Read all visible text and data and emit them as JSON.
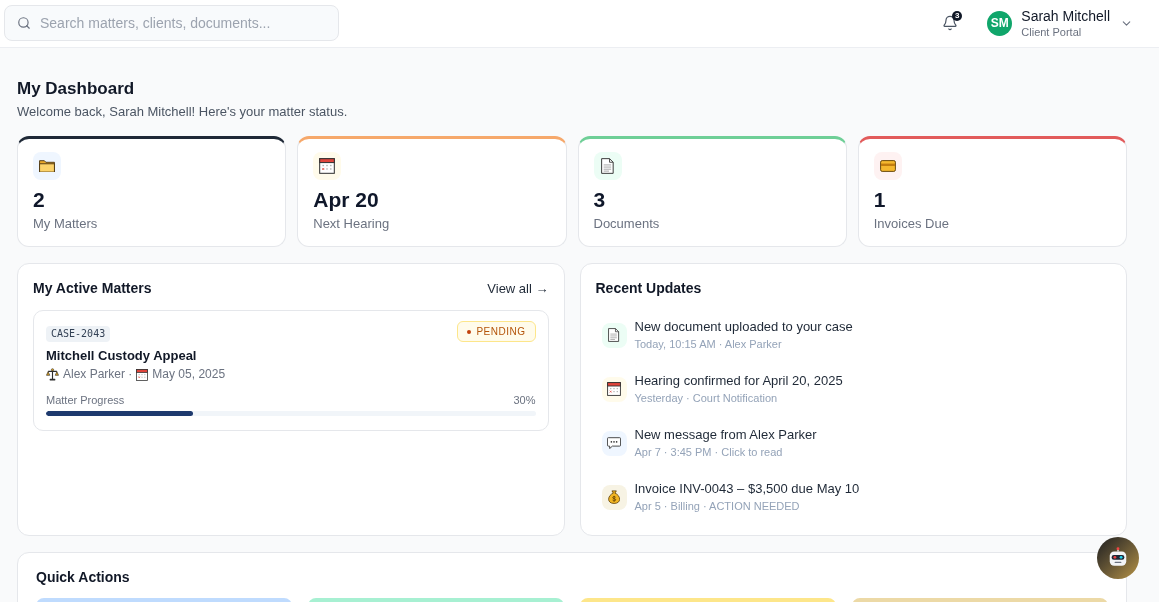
{
  "search": {
    "placeholder": "Search matters, clients, documents..."
  },
  "notifications": {
    "count": "3"
  },
  "user": {
    "initials": "SM",
    "name": "Sarah Mitchell",
    "role": "Client Portal"
  },
  "header": {
    "title": "My Dashboard",
    "subtitle": "Welcome back, Sarah Mitchell! Here's your matter status."
  },
  "stats": [
    {
      "kind": "folder",
      "value": "2",
      "label": "My Matters",
      "color": "#1f2937"
    },
    {
      "kind": "calendar",
      "value": "Apr 20",
      "label": "Next Hearing",
      "color": "#f6a86b"
    },
    {
      "kind": "document",
      "value": "3",
      "label": "Documents",
      "color": "#6fcf97"
    },
    {
      "kind": "card",
      "value": "1",
      "label": "Invoices Due",
      "color": "#e25b5b"
    }
  ],
  "active_matters": {
    "title": "My Active Matters",
    "link": "View all →",
    "matters": [
      {
        "case_id": "CASE-2043",
        "status": "PENDING",
        "title": "Mitchell Custody Appeal",
        "lawyer": "Alex Parker ·",
        "date": "May 05, 2025",
        "progress_label": "Matter Progress",
        "progress_value": "30%",
        "level": 0.3
      }
    ]
  },
  "recent_updates": {
    "title": "Recent Updates",
    "items": [
      {
        "kind": "document",
        "text": "New document uploaded to your case",
        "meta": "Today, 10:15 AM · Alex Parker"
      },
      {
        "kind": "calendar",
        "text": "Hearing confirmed for April 20, 2025",
        "meta": "Yesterday · Court Notification"
      },
      {
        "kind": "chat",
        "text": "New message from Alex Parker",
        "meta": "Apr 7 · 3:45 PM · Click to read"
      },
      {
        "kind": "money",
        "text": "Invoice INV-0043 – $3,500 due May 10",
        "meta": "Apr 5 · Billing · ACTION NEEDED"
      }
    ]
  },
  "quick_actions": {
    "title": "Quick Actions",
    "tiles": [
      {
        "color": "#bfdbfe"
      },
      {
        "color": "#a7f0d2"
      },
      {
        "color": "#fde68a"
      },
      {
        "color": "#ecd9a6"
      }
    ]
  }
}
